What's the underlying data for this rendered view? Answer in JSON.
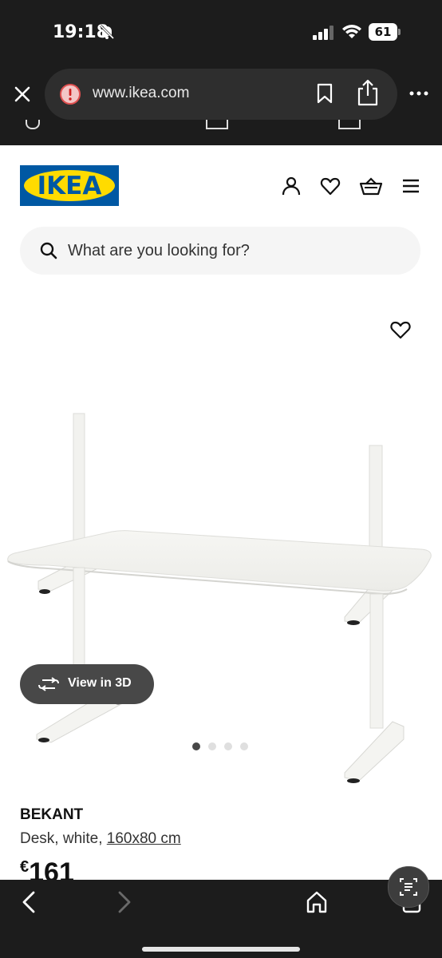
{
  "status_bar": {
    "time": "19:18",
    "battery": "61"
  },
  "browser": {
    "url": "www.ikea.com"
  },
  "header": {
    "logo_text": "IKEA"
  },
  "search": {
    "placeholder": "What are you looking for?"
  },
  "gallery": {
    "view_3d_label": "View in 3D",
    "dots_count": 4,
    "active_dot": 0
  },
  "product": {
    "name": "BEKANT",
    "description": "Desk, white, ",
    "size": "160x80 cm",
    "currency": "€",
    "price": "161"
  },
  "colors": {
    "ikea_blue": "#0058a3",
    "ikea_yellow": "#ffdb00",
    "chrome": "#1c1c1c"
  }
}
